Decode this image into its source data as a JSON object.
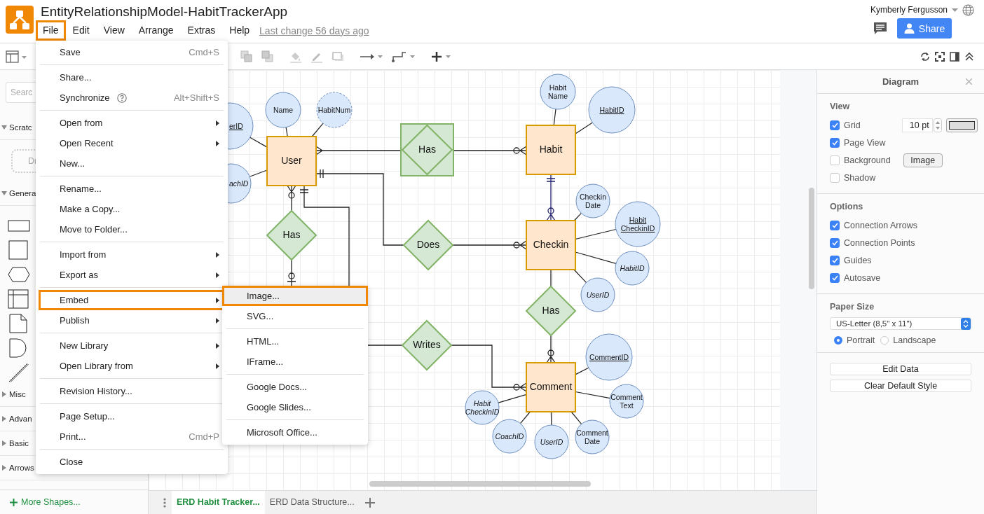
{
  "window": {
    "title": "EntityRelationshipModel-HabitTrackerApp",
    "last_change": "Last change 56 days ago",
    "user": "Kymberly Fergusson",
    "share": "Share"
  },
  "menubar": [
    {
      "label": "File",
      "selected": true
    },
    {
      "label": "Edit",
      "selected": false
    },
    {
      "label": "View",
      "selected": false
    },
    {
      "label": "Arrange",
      "selected": false
    },
    {
      "label": "Extras",
      "selected": false
    },
    {
      "label": "Help",
      "selected": false
    }
  ],
  "sidebar": {
    "search": {
      "placeholder": "Searc"
    },
    "sections": [
      {
        "label": "Scratc",
        "expanded": true
      },
      {
        "label": "Genera",
        "expanded": true
      },
      {
        "label": "Misc",
        "expanded": false
      },
      {
        "label": "Advan",
        "expanded": false
      },
      {
        "label": "Basic",
        "expanded": false
      },
      {
        "label": "Arrows",
        "expanded": false
      }
    ],
    "scratch_hint": "Dr",
    "more_shapes": "More Shapes..."
  },
  "file_menu": {
    "groups": [
      [
        {
          "label": "Save",
          "shortcut": "Cmd+S",
          "submenu": false,
          "selected": false
        }
      ],
      [
        {
          "label": "Share...",
          "submenu": false,
          "selected": false
        },
        {
          "label": "Synchronize",
          "help": true,
          "shortcut": "Alt+Shift+S",
          "submenu": false,
          "selected": false
        }
      ],
      [
        {
          "label": "Open from",
          "submenu": true,
          "selected": false
        },
        {
          "label": "Open Recent",
          "submenu": true,
          "selected": false
        },
        {
          "label": "New...",
          "submenu": false,
          "selected": false
        }
      ],
      [
        {
          "label": "Rename...",
          "submenu": false,
          "selected": false
        },
        {
          "label": "Make a Copy...",
          "submenu": false,
          "selected": false
        },
        {
          "label": "Move to Folder...",
          "submenu": false,
          "selected": false
        }
      ],
      [
        {
          "label": "Import from",
          "submenu": true,
          "selected": false
        },
        {
          "label": "Export as",
          "submenu": true,
          "selected": false
        }
      ],
      [
        {
          "label": "Embed",
          "submenu": true,
          "selected": true
        },
        {
          "label": "Publish",
          "submenu": true,
          "selected": false
        }
      ],
      [
        {
          "label": "New Library",
          "submenu": true,
          "selected": false
        },
        {
          "label": "Open Library from",
          "submenu": true,
          "selected": false
        }
      ],
      [
        {
          "label": "Revision History...",
          "submenu": false,
          "selected": false
        }
      ],
      [
        {
          "label": "Page Setup...",
          "submenu": false,
          "selected": false
        },
        {
          "label": "Print...",
          "shortcut": "Cmd+P",
          "submenu": false,
          "selected": false
        }
      ],
      [
        {
          "label": "Close",
          "submenu": false,
          "selected": false
        }
      ]
    ]
  },
  "embed_menu": {
    "groups": [
      [
        {
          "label": "Image...",
          "selected": true
        },
        {
          "label": "SVG...",
          "selected": false
        }
      ],
      [
        {
          "label": "HTML...",
          "selected": false
        },
        {
          "label": "IFrame...",
          "selected": false
        }
      ],
      [
        {
          "label": "Google Docs...",
          "selected": false
        },
        {
          "label": "Google Slides...",
          "selected": false
        }
      ],
      [
        {
          "label": "Microsoft Office...",
          "selected": false
        }
      ]
    ]
  },
  "diagram": {
    "nodes": [
      {
        "kind": "entity",
        "lines": [
          "User"
        ]
      },
      {
        "kind": "entity",
        "lines": [
          "Habit"
        ]
      },
      {
        "kind": "entity",
        "lines": [
          "Checkin"
        ]
      },
      {
        "kind": "entity",
        "lines": [
          "Comment"
        ]
      },
      {
        "kind": "weak_relationship",
        "lines": [
          "Has"
        ]
      },
      {
        "kind": "relationship",
        "lines": [
          "Has"
        ]
      },
      {
        "kind": "relationship",
        "lines": [
          "Does"
        ]
      },
      {
        "kind": "relationship",
        "lines": [
          "Has"
        ]
      },
      {
        "kind": "relationship",
        "lines": [
          "Writes"
        ]
      },
      {
        "kind": "attribute",
        "lines": [
          "erID"
        ]
      },
      {
        "kind": "attribute",
        "lines": [
          "achID"
        ]
      },
      {
        "kind": "attribute",
        "lines": [
          "Name"
        ]
      },
      {
        "kind": "attribute",
        "lines": [
          "HabitNum"
        ]
      },
      {
        "kind": "attribute",
        "lines": [
          "Habit",
          "Name"
        ]
      },
      {
        "kind": "attribute",
        "lines": [
          "HabitID"
        ]
      },
      {
        "kind": "attribute",
        "lines": [
          "Checkin",
          "Date"
        ]
      },
      {
        "kind": "attribute",
        "lines": [
          "Habit",
          "CheckinID"
        ]
      },
      {
        "kind": "attribute",
        "lines": [
          "HabitID"
        ]
      },
      {
        "kind": "attribute",
        "lines": [
          "UserID"
        ]
      },
      {
        "kind": "attribute",
        "lines": [
          "CommentID"
        ]
      },
      {
        "kind": "attribute",
        "lines": [
          "Comment",
          "Text"
        ]
      },
      {
        "kind": "attribute",
        "lines": [
          "Habit",
          "CheckinID"
        ]
      },
      {
        "kind": "attribute",
        "lines": [
          "CoachID"
        ]
      },
      {
        "kind": "attribute",
        "lines": [
          "UserID"
        ]
      },
      {
        "kind": "attribute",
        "lines": [
          "Comment",
          "Date"
        ]
      }
    ]
  },
  "format_panel": {
    "title": "Diagram",
    "view": {
      "title": "View",
      "options": [
        {
          "label": "Grid",
          "checked": true
        },
        {
          "label": "Page View",
          "checked": true
        },
        {
          "label": "Background",
          "checked": false
        },
        {
          "label": "Shadow",
          "checked": false
        }
      ],
      "grid_size": "10 pt",
      "image_button": "Image"
    },
    "options": {
      "title": "Options",
      "items": [
        {
          "label": "Connection Arrows",
          "checked": true
        },
        {
          "label": "Connection Points",
          "checked": true
        },
        {
          "label": "Guides",
          "checked": true
        },
        {
          "label": "Autosave",
          "checked": true
        }
      ]
    },
    "paper": {
      "title": "Paper Size",
      "size": "US-Letter (8,5\" x 11\")",
      "orientations": [
        {
          "label": "Portrait",
          "selected": true
        },
        {
          "label": "Landscape",
          "selected": false
        }
      ]
    },
    "buttons": [
      "Edit Data",
      "Clear Default Style"
    ]
  },
  "page_tabs": [
    {
      "label": "ERD Habit Tracker...",
      "selected": true
    },
    {
      "label": "ERD Data Structure...",
      "selected": false
    }
  ]
}
